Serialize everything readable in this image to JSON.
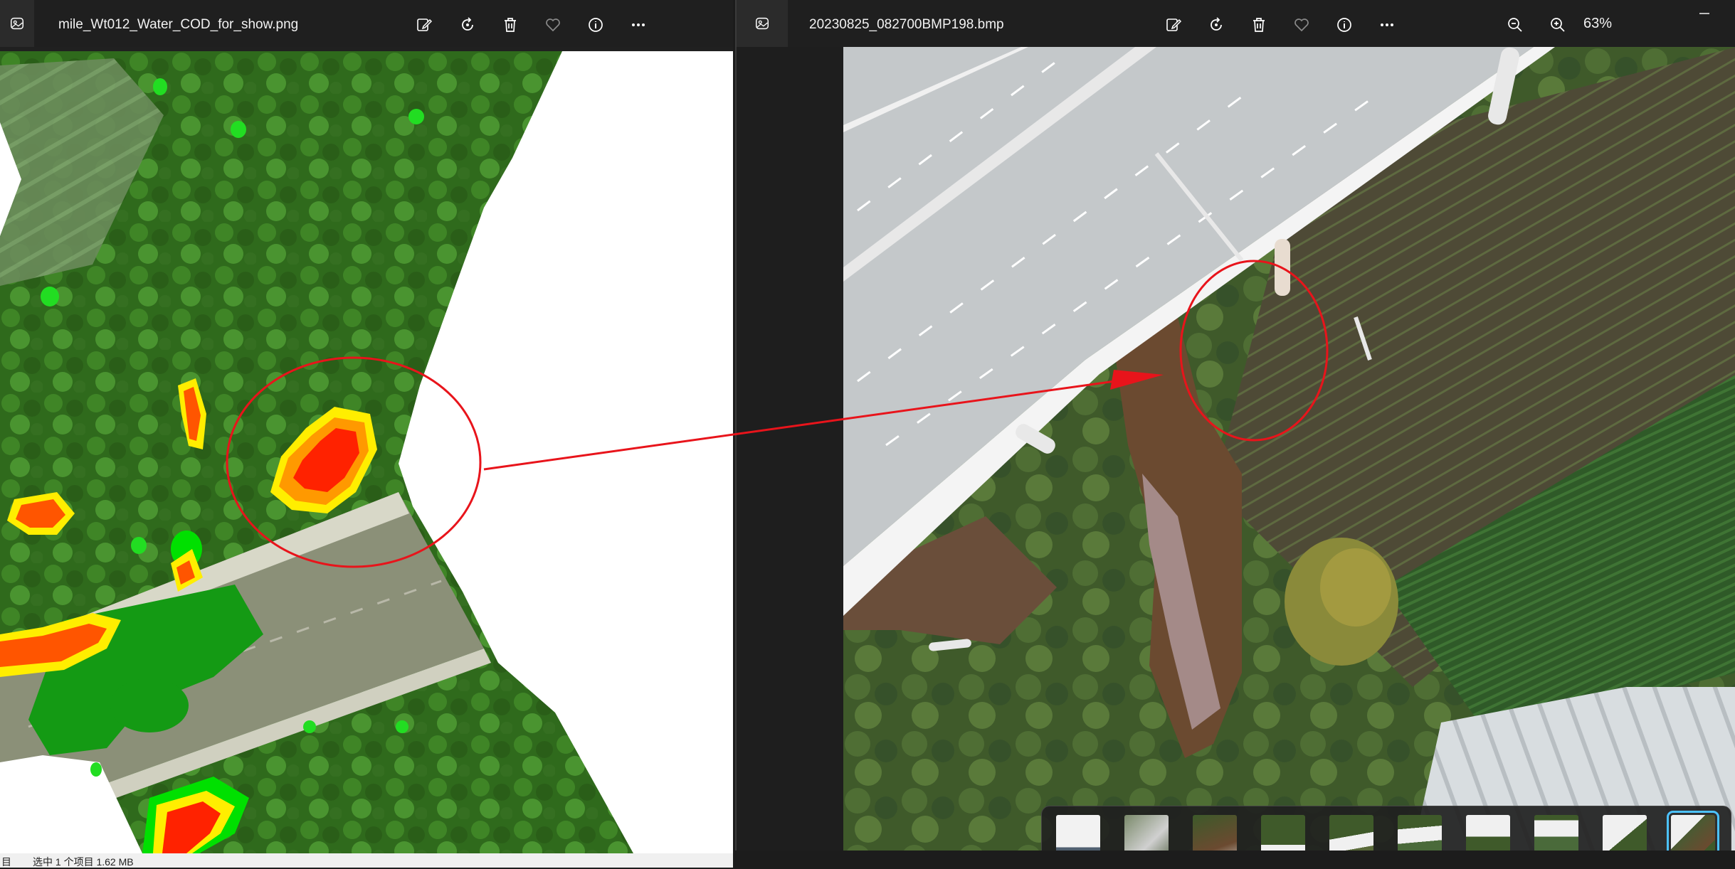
{
  "left_window": {
    "filename": "mile_Wt012_Water_COD_for_show.png",
    "tools": [
      "edit-icon",
      "rotate-icon",
      "delete-icon",
      "favorite-icon",
      "info-icon",
      "more-icon"
    ]
  },
  "right_window": {
    "filename": "20230825_082700BMP198.bmp",
    "tools": [
      "edit-icon",
      "rotate-icon",
      "delete-icon",
      "favorite-icon",
      "info-icon",
      "more-icon"
    ],
    "zoom_level": "63%",
    "filmstrip_count": 10,
    "active_thumb": 10
  },
  "statusbar": {
    "left_char": "目",
    "selection_text": "选中 1 个项目 1.62 MB"
  },
  "annotation": {
    "stroke_color": "#e8141b",
    "shape_left": "ellipse",
    "shape_right": "ellipse",
    "connector": "arrow"
  },
  "colors": {
    "titlebar": "#1f1f1f",
    "accent": "#4cc2ff",
    "cod_high": "#ff2200",
    "cod_mid": "#ff9900",
    "cod_low": "#00e000"
  }
}
